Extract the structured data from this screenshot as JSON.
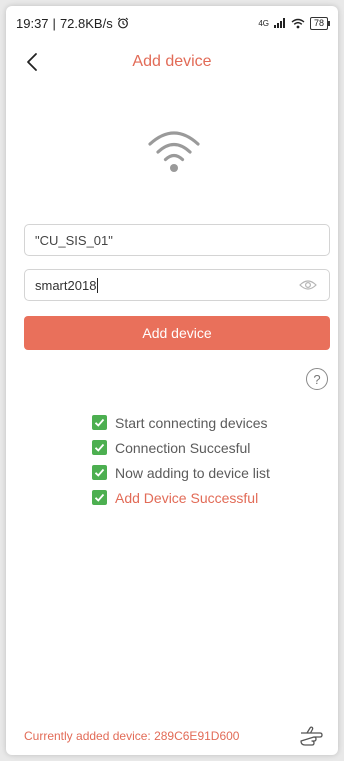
{
  "status_bar": {
    "time": "19:37",
    "network_speed": "72.8KB/s",
    "signal": "4G",
    "battery": "78"
  },
  "header": {
    "title": "Add device"
  },
  "form": {
    "ssid_value": "\"CU_SIS_01\"",
    "password_value": "smart2018",
    "submit_label": "Add device",
    "help_label": "?"
  },
  "steps": [
    {
      "label": "Start connecting devices",
      "done": true
    },
    {
      "label": "Connection Succesful",
      "done": true
    },
    {
      "label": "Now adding to device list",
      "done": true
    },
    {
      "label": "Add Device Successful",
      "done": true
    }
  ],
  "footer": {
    "current_device_text": "Currently added device: 289C6E91D600"
  },
  "colors": {
    "accent": "#e9705b",
    "accent_text": "#e26b57",
    "check_green": "#4caf50"
  },
  "icons": {
    "back": "chevron-left-icon",
    "wifi": "wifi-icon",
    "eye": "eye-icon",
    "help": "question-circle-icon",
    "alarm": "alarm-icon",
    "hand": "pointing-hand-icon"
  }
}
